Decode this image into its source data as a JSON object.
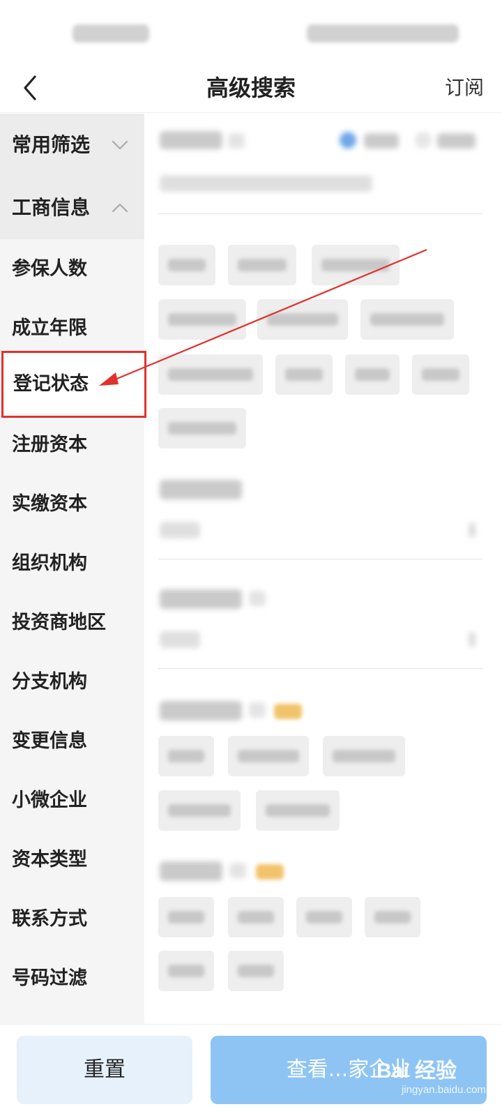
{
  "header": {
    "title": "高级搜索",
    "subscribe_label": "订阅"
  },
  "sidebar": {
    "sections": [
      {
        "label": "常用筛选",
        "state": "collapsed"
      },
      {
        "label": "工商信息",
        "state": "expanded"
      }
    ],
    "items": [
      {
        "label": "参保人数"
      },
      {
        "label": "成立年限"
      },
      {
        "label": "登记状态",
        "highlighted": true
      },
      {
        "label": "注册资本"
      },
      {
        "label": "实缴资本"
      },
      {
        "label": "组织机构"
      },
      {
        "label": "投资商地区"
      },
      {
        "label": "分支机构"
      },
      {
        "label": "变更信息"
      },
      {
        "label": "小微企业"
      },
      {
        "label": "资本类型"
      },
      {
        "label": "联系方式"
      },
      {
        "label": "号码过滤"
      }
    ]
  },
  "footer": {
    "reset_label": "重置",
    "view_label": "查看...家企业"
  },
  "watermark": {
    "main": "Bai 经验",
    "cn": "经验",
    "sub": "jingyan.baidu.com"
  },
  "colors": {
    "annotation_red": "#e0322c",
    "primary_light_blue": "#8ec4f4",
    "reset_bg": "#e6f1fc",
    "sidebar_bg": "#f5f5f5"
  },
  "icons": {
    "back": "chevron-left-icon",
    "collapsed": "chevron-down-icon",
    "expanded": "chevron-up-icon"
  }
}
